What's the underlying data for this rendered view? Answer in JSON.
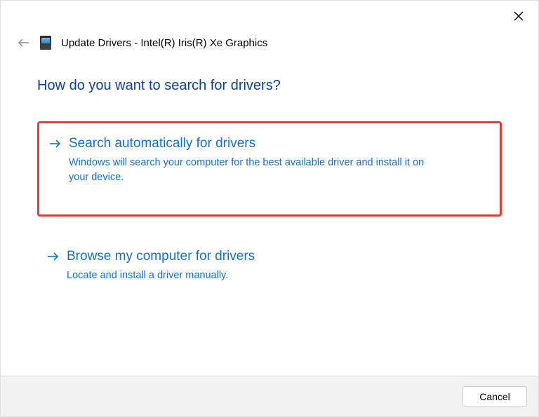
{
  "close_label": "Close",
  "header": {
    "title": "Update Drivers - Intel(R) Iris(R) Xe Graphics"
  },
  "main_heading": "How do you want to search for drivers?",
  "options": [
    {
      "title": "Search automatically for drivers",
      "description": "Windows will search your computer for the best available driver and install it on your device."
    },
    {
      "title": "Browse my computer for drivers",
      "description": "Locate and install a driver manually."
    }
  ],
  "footer": {
    "cancel_label": "Cancel"
  }
}
